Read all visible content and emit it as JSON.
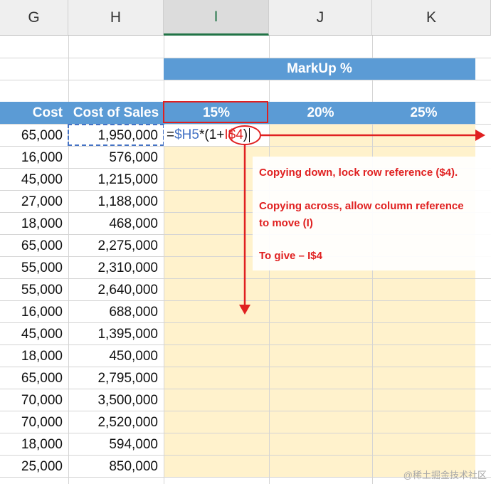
{
  "columns": [
    "G",
    "H",
    "I",
    "J",
    "K"
  ],
  "markup_title": "MarkUp %",
  "headers": {
    "cost": "Cost",
    "cost_of_sales": "Cost of Sales",
    "pct_15": "15%",
    "pct_20": "20%",
    "pct_25": "25%"
  },
  "rows": [
    {
      "cost": "65,000",
      "sales": "1,950,000"
    },
    {
      "cost": "16,000",
      "sales": "576,000"
    },
    {
      "cost": "45,000",
      "sales": "1,215,000"
    },
    {
      "cost": "27,000",
      "sales": "1,188,000"
    },
    {
      "cost": "18,000",
      "sales": "468,000"
    },
    {
      "cost": "65,000",
      "sales": "2,275,000"
    },
    {
      "cost": "55,000",
      "sales": "2,310,000"
    },
    {
      "cost": "55,000",
      "sales": "2,640,000"
    },
    {
      "cost": "16,000",
      "sales": "688,000"
    },
    {
      "cost": "45,000",
      "sales": "1,395,000"
    },
    {
      "cost": "18,000",
      "sales": "450,000"
    },
    {
      "cost": "65,000",
      "sales": "2,795,000"
    },
    {
      "cost": "70,000",
      "sales": "3,500,000"
    },
    {
      "cost": "70,000",
      "sales": "2,520,000"
    },
    {
      "cost": "18,000",
      "sales": "594,000"
    },
    {
      "cost": "25,000",
      "sales": "850,000"
    }
  ],
  "formula": {
    "eq": "=",
    "ref_h": "$H5",
    "mid": "*(1+",
    "ref_i": "I$4",
    "close": ")"
  },
  "notes": {
    "line1": "Copying down, lock row reference ($4).",
    "line2a": "Copying across, allow column reference",
    "line2b": "to move (I)",
    "line3": "To give – I$4"
  },
  "watermark": "@稀土掘金技术社区",
  "colors": {
    "header_blue": "#5b9bd5",
    "cell_yellow": "#fff2cc",
    "annotation_red": "#e02020",
    "formula_ref_blue": "#4472c4",
    "formula_ref_red": "#e02020"
  }
}
